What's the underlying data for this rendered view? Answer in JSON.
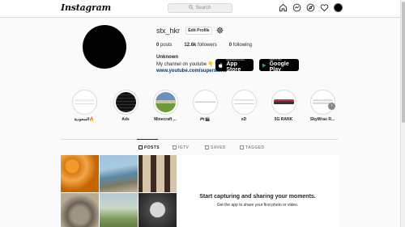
{
  "nav": {
    "logo": "Instagram",
    "search_placeholder": "Search",
    "icons": [
      "home-icon",
      "messenger-icon",
      "explore-icon",
      "heart-icon",
      "avatar"
    ]
  },
  "profile": {
    "username": "stx_hkr",
    "edit_label": "Edit Profile",
    "posts_count": "0",
    "posts_label": "posts",
    "followers_count": "12.6k",
    "followers_label": "followers",
    "following_count": "0",
    "following_label": "following",
    "full_name": "Unknown",
    "bio": "My channel on youtube 👇👇",
    "link": "www.youtube.com/superstand"
  },
  "highlights": [
    {
      "label": "السعودية🔥"
    },
    {
      "label": "Ads"
    },
    {
      "label": "Minecraft ..."
    },
    {
      "label": "🎮🎬"
    },
    {
      "label": "xD"
    },
    {
      "label": "5G RANK"
    },
    {
      "label": "SkyWras R..."
    }
  ],
  "tabs": [
    {
      "label": "POSTS",
      "active": true
    },
    {
      "label": "IGTV",
      "active": false
    },
    {
      "label": "SAVED",
      "active": false
    },
    {
      "label": "TAGGED",
      "active": false
    }
  ],
  "empty_state": {
    "title": "Start capturing and sharing your moments.",
    "subtitle": "Get the app to share your first photo or video.",
    "appstore_small": "Download on the",
    "appstore_big": "App Store",
    "gplay_small": "GET IT ON",
    "gplay_big": "Google Play"
  },
  "colors": {
    "background": "#fafafa",
    "border": "#dbdbdb",
    "link": "#00376b"
  }
}
